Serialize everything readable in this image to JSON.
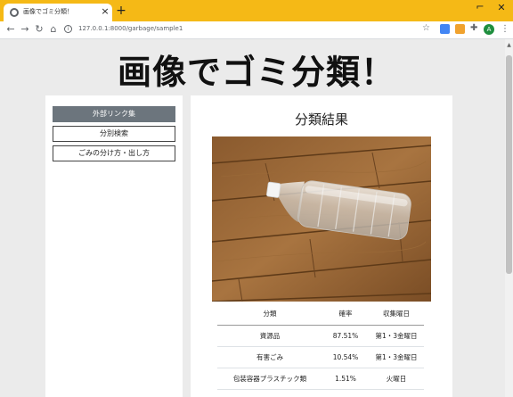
{
  "browser": {
    "tab_title": "画像でゴミ分類！",
    "url": "127.0.0.1:8000/garbage/sample1",
    "colors": {
      "tabbar": "#f5b916"
    }
  },
  "header": {
    "title": "画像でゴミ分類！"
  },
  "sidebar": {
    "items": [
      {
        "label": "外部リンク集",
        "active": true
      },
      {
        "label": "分別検索",
        "active": false
      },
      {
        "label": "ごみの分け方・出し方",
        "active": false
      }
    ]
  },
  "main": {
    "heading": "分類結果",
    "table": {
      "headers": [
        "分類",
        "確率",
        "収集曜日"
      ],
      "rows": [
        [
          "資源品",
          "87.51%",
          "第1・3金曜日"
        ],
        [
          "有害ごみ",
          "10.54%",
          "第1・3金曜日"
        ],
        [
          "包装容器プラスチック類",
          "1.51%",
          "火曜日"
        ]
      ]
    }
  }
}
